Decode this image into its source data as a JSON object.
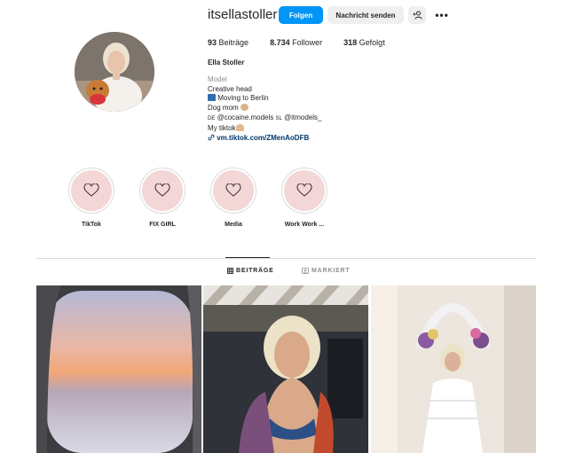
{
  "profile": {
    "username": "itsellastoller",
    "follow_label": "Folgen",
    "message_label": "Nachricht senden",
    "suggest_icon": "add-person-icon",
    "more_icon": "more-options-icon",
    "more_glyph": "•••"
  },
  "stats": {
    "posts_count": "93",
    "posts_label": "Beiträge",
    "followers_count": "8.734",
    "followers_label": "Follower",
    "following_count": "318",
    "following_label": "Gefolgt"
  },
  "bio": {
    "full_name": "Ella Stoller",
    "category": "Model",
    "line1": "Creative head",
    "line2": "Moving to Berlin",
    "line3": "Dog mom",
    "line4_prefix": "DE",
    "line4_agency1": "@cocaine.models",
    "line4_mid": "SL",
    "line4_agency2": "@itmodels_",
    "line5": "My tiktok",
    "link": "vm.tiktok.com/ZMenAoDFB"
  },
  "highlights": [
    {
      "label": "TikTok"
    },
    {
      "label": "FIX GIRL"
    },
    {
      "label": "Media"
    },
    {
      "label": "Work Work ..."
    }
  ],
  "tabs": {
    "posts_label": "BEITRÄGE",
    "tagged_label": "MARKIERT"
  },
  "colors": {
    "accent": "#0095f6",
    "highlight_fill": "#f3d6d6",
    "link": "#00376b"
  }
}
